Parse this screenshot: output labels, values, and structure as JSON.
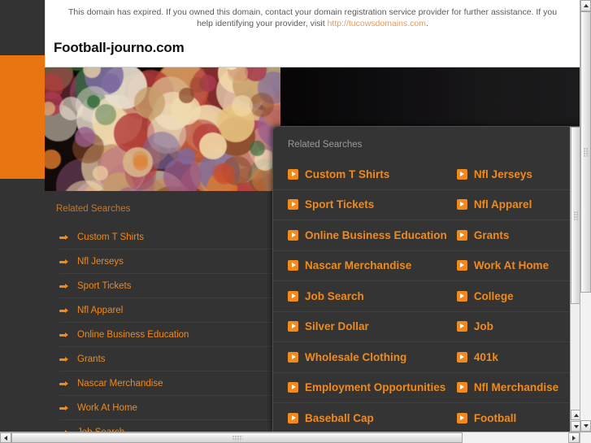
{
  "notice": {
    "text": "This domain has expired. If you owned this domain, contact your domain registration service provider for further assistance. If you help identifying your provider, visit ",
    "line1": "This domain has expired. If you owned this domain, contact your domain registration service provider for further assistance. If you",
    "line2_prefix": "help identifying your provider, visit ",
    "link_text": "http://tucowsdomains.com",
    "line2_suffix": "."
  },
  "domain_title": "Football-journo.com",
  "search": {
    "value": "",
    "placeholder": "",
    "icon": "search-icon"
  },
  "sidebar": {
    "heading": "Related Searches",
    "items": [
      {
        "label": "Custom T Shirts"
      },
      {
        "label": "Nfl Jerseys"
      },
      {
        "label": "Sport Tickets"
      },
      {
        "label": "Nfl Apparel"
      },
      {
        "label": "Online Business Education"
      },
      {
        "label": "Grants"
      },
      {
        "label": "Nascar Merchandise"
      },
      {
        "label": "Work At Home"
      },
      {
        "label": "Job Search"
      }
    ]
  },
  "overlay": {
    "heading": "Related Searches",
    "rows": [
      {
        "left": "Custom T Shirts",
        "right": "Nfl Jerseys"
      },
      {
        "left": "Sport Tickets",
        "right": "Nfl Apparel"
      },
      {
        "left": "Online Business Education",
        "right": "Grants"
      },
      {
        "left": "Nascar Merchandise",
        "right": "Work At Home"
      },
      {
        "left": "Job Search",
        "right": "College"
      },
      {
        "left": "Silver Dollar",
        "right": "Job"
      },
      {
        "left": "Wholesale Clothing",
        "right": "401k"
      },
      {
        "left": "Employment Opportunities",
        "right": "Nfl Merchandise"
      },
      {
        "left": "Baseball Cap",
        "right": "Football"
      }
    ]
  },
  "colors": {
    "orange_accent": "#f08a1c",
    "orange_block": "#e87511",
    "dark_bg": "#333333",
    "panel_bg": "#343434",
    "heading_muted": "#9a9a9a",
    "sidebar_heading": "#c07a33",
    "link": "#e8995a"
  }
}
